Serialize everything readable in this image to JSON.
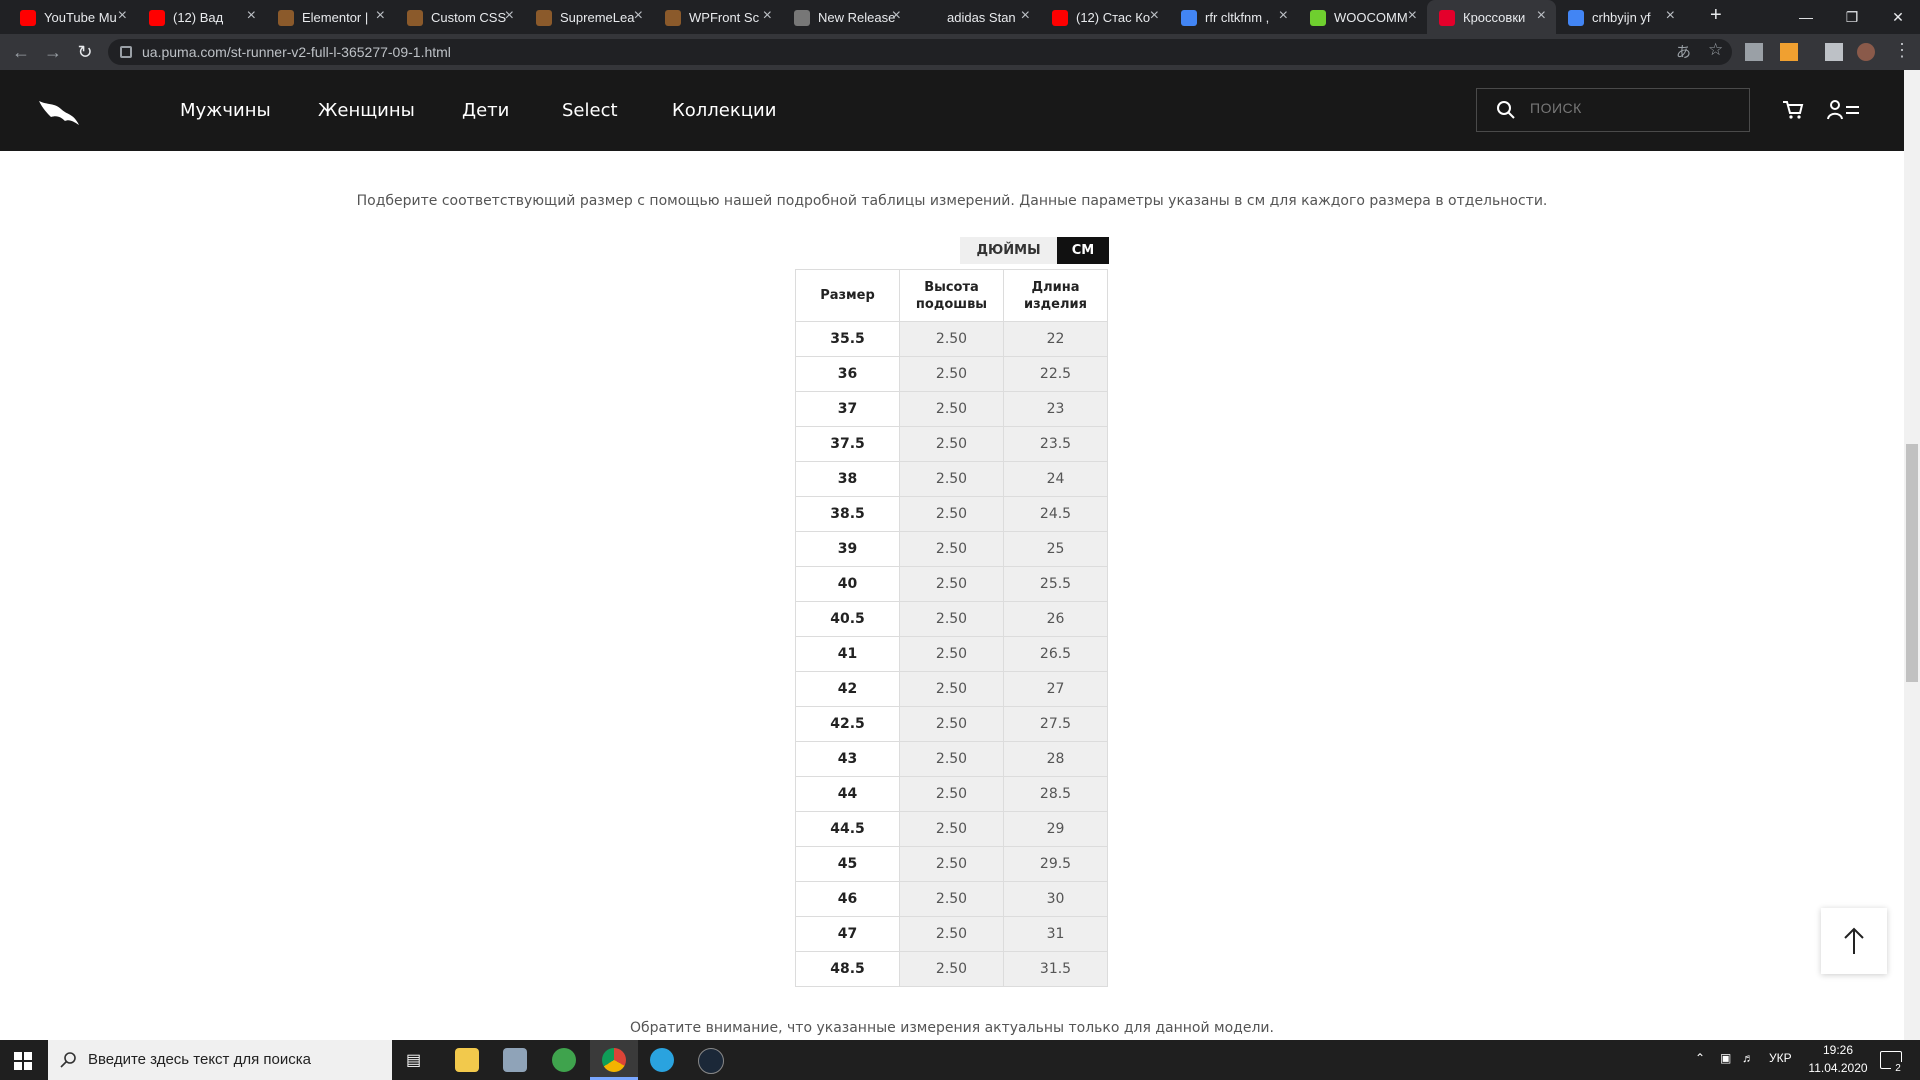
{
  "browser": {
    "tabs": [
      {
        "title": "YouTube Mu",
        "favicon": "youtube-icon",
        "color": "#ff0000"
      },
      {
        "title": "(12) Вад",
        "favicon": "youtube-icon",
        "color": "#ff0000"
      },
      {
        "title": "Elementor |",
        "favicon": "site-icon",
        "color": "#8b5a2b"
      },
      {
        "title": "Custom CSS",
        "favicon": "site-icon",
        "color": "#8b5a2b"
      },
      {
        "title": "SupremeLea",
        "favicon": "site-icon",
        "color": "#8b5a2b"
      },
      {
        "title": "WPFront Sc",
        "favicon": "site-icon",
        "color": "#8b5a2b"
      },
      {
        "title": "New Release",
        "favicon": "nike-icon",
        "color": "#777777"
      },
      {
        "title": "adidas Stan",
        "favicon": "adidas-icon",
        "color": "#202124"
      },
      {
        "title": "(12) Стас Ко",
        "favicon": "youtube-icon",
        "color": "#ff0000"
      },
      {
        "title": "rfr cltkfnm ,",
        "favicon": "google-icon",
        "color": "#4285f4"
      },
      {
        "title": "WOOCOMM",
        "favicon": "arrow-up-icon",
        "color": "#6fcf2f"
      },
      {
        "title": "Кроссовки",
        "favicon": "puma-icon",
        "color": "#e4002b"
      },
      {
        "title": "crhbyijn yf",
        "favicon": "google-icon",
        "color": "#4285f4"
      }
    ],
    "url": "ua.puma.com/st-runner-v2-full-l-365277-09-1.html"
  },
  "site": {
    "nav": [
      "Мужчины",
      "Женщины",
      "Дети",
      "Select",
      "Коллекции"
    ],
    "search_placeholder": "ПОИСК"
  },
  "size_guide": {
    "intro": "Подберите соответствующий размер с помощью нашей подробной таблицы измерений. Данные параметры указаны в см для каждого размера в отдельности.",
    "unit_inches": "ДЮЙМЫ",
    "unit_cm": "СМ",
    "headers": [
      "Размер",
      "Высота подошвы",
      "Длина изделия"
    ],
    "rows": [
      [
        "35.5",
        "2.50",
        "22"
      ],
      [
        "36",
        "2.50",
        "22.5"
      ],
      [
        "37",
        "2.50",
        "23"
      ],
      [
        "37.5",
        "2.50",
        "23.5"
      ],
      [
        "38",
        "2.50",
        "24"
      ],
      [
        "38.5",
        "2.50",
        "24.5"
      ],
      [
        "39",
        "2.50",
        "25"
      ],
      [
        "40",
        "2.50",
        "25.5"
      ],
      [
        "40.5",
        "2.50",
        "26"
      ],
      [
        "41",
        "2.50",
        "26.5"
      ],
      [
        "42",
        "2.50",
        "27"
      ],
      [
        "42.5",
        "2.50",
        "27.5"
      ],
      [
        "43",
        "2.50",
        "28"
      ],
      [
        "44",
        "2.50",
        "28.5"
      ],
      [
        "44.5",
        "2.50",
        "29"
      ],
      [
        "45",
        "2.50",
        "29.5"
      ],
      [
        "46",
        "2.50",
        "30"
      ],
      [
        "47",
        "2.50",
        "31"
      ],
      [
        "48.5",
        "2.50",
        "31.5"
      ]
    ],
    "note": "Обратите внимание, что указанные измерения актуальны только для данной модели."
  },
  "taskbar": {
    "search_placeholder": "Введите здесь текст для поиска",
    "lang": "УКР",
    "time": "19:26",
    "date": "11.04.2020",
    "notifications": "2"
  }
}
